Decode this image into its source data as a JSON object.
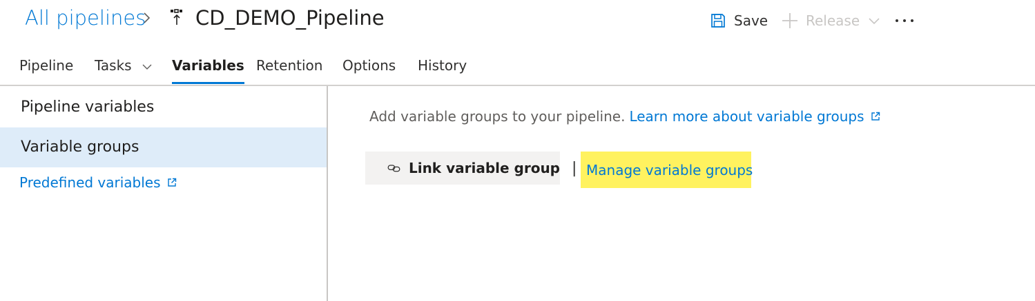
{
  "header": {
    "breadcrumb_root": "All pipelines",
    "pipeline_name": "CD_DEMO_Pipeline",
    "save_label": "Save",
    "release_label": "Release",
    "more_label": "···"
  },
  "tabs": [
    {
      "label": "Pipeline"
    },
    {
      "label": "Tasks"
    },
    {
      "label": "Variables",
      "active": true
    },
    {
      "label": "Retention"
    },
    {
      "label": "Options"
    },
    {
      "label": "History"
    }
  ],
  "sidebar": {
    "items": [
      {
        "label": "Pipeline variables"
      },
      {
        "label": "Variable groups",
        "selected": true
      }
    ],
    "predefined_link": "Predefined variables"
  },
  "main": {
    "info_text": "Add variable groups to your pipeline.",
    "learn_more_link": "Learn more about variable groups",
    "link_button_label": "Link variable group",
    "separator": "|",
    "manage_link": "Manage variable groups",
    "manage_highlight_color": "#fff25f"
  },
  "colors": {
    "accent": "#0078d4",
    "selected_bg": "#deecf9"
  }
}
